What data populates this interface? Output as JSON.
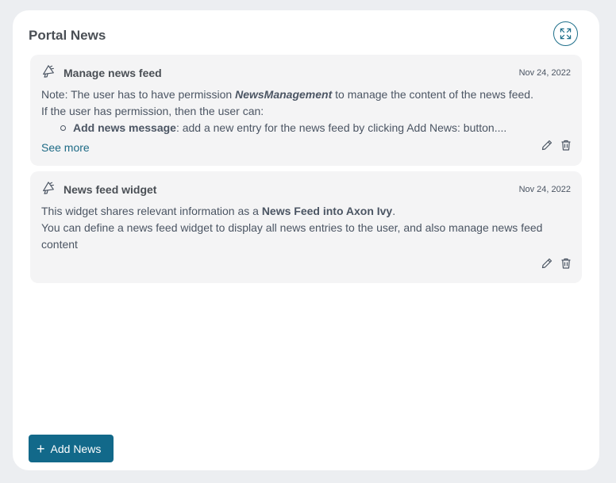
{
  "widget": {
    "title": "Portal News",
    "expand_icon": "expand-arrows-icon"
  },
  "news": [
    {
      "title": "Manage news feed",
      "date": "Nov 24, 2022",
      "icon": "megaphone-icon",
      "body": {
        "line1_prefix": "Note: The user has to have permission ",
        "line1_emph": "NewsManagement",
        "line1_suffix": " to manage the content of the news feed.",
        "line2": "If the user has permission, then the user can:",
        "bullet_bold": "Add news message",
        "bullet_rest": ": add a new entry for the news feed by clicking Add News: button...."
      },
      "see_more": "See more"
    },
    {
      "title": "News feed widget",
      "date": "Nov 24, 2022",
      "icon": "megaphone-icon",
      "body": {
        "line1_prefix": "This widget shares relevant information as a ",
        "line1_bold": "News Feed into Axon Ivy",
        "line1_suffix": ".",
        "line2": "You can define a news feed widget to display all news entries to the user, and also manage news feed content"
      }
    }
  ],
  "footer": {
    "add_label": "Add News"
  },
  "colors": {
    "accent": "#12698a",
    "link": "#1d6a85",
    "card_bg": "#f4f4f5",
    "page_bg": "#eceef1"
  }
}
